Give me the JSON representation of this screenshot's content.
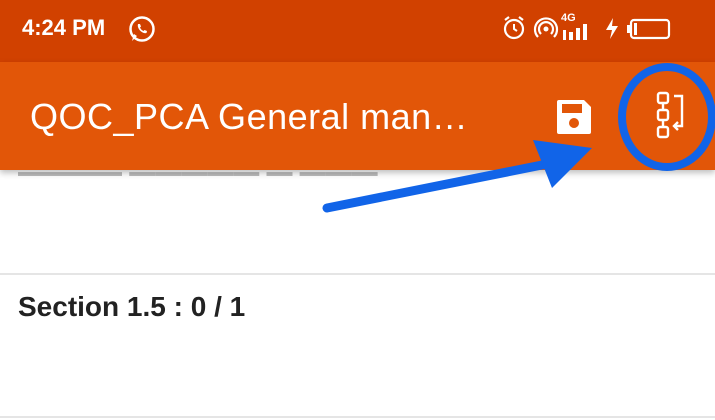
{
  "status_bar": {
    "time": "4:24 PM",
    "network": "4G",
    "icons": [
      "whatsapp-icon",
      "alarm-icon",
      "hotspot-icon",
      "signal-icon",
      "battery-icon"
    ]
  },
  "app_bar": {
    "title": "QOC_PCA General man…",
    "background": "#e25608",
    "actions": [
      "save-icon",
      "flow-icon"
    ]
  },
  "content": {
    "section_label": "Section 1.5 : 0 / 1"
  },
  "annotation": {
    "color": "#1164e8"
  }
}
